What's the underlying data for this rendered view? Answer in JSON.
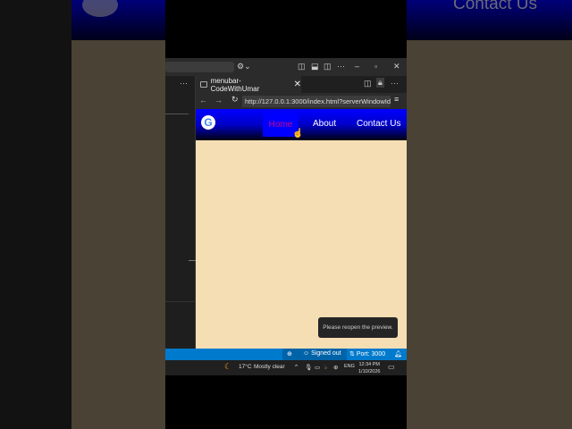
{
  "background": {
    "contact_label": "Contact Us"
  },
  "title_bar": {
    "more": "···",
    "min": "–",
    "max": "▫",
    "close": "✕"
  },
  "left_panel": {
    "more": "···"
  },
  "browser": {
    "tab_title": "menubar-CodeWithUmar",
    "url": "http://127.0.0.1:3000/index.html?serverWindowId",
    "more": "···"
  },
  "page": {
    "logo_letter": "G",
    "nav": [
      {
        "label": "Home",
        "active": true
      },
      {
        "label": "About"
      },
      {
        "label": "Contact Us"
      }
    ],
    "toast": "Please reopen the preview."
  },
  "status_bar": {
    "account": "Signed out",
    "port": "Port: 3000"
  },
  "taskbar": {
    "weather": "17°C",
    "condition": "Mostly clear",
    "lang": "ENG",
    "time": "12:34 PM",
    "date": "1/10/2026"
  },
  "colors": {
    "nav_blue": "#0000ff",
    "home_text": "#d0008a",
    "page_bg": "#f5deb3",
    "status": "#007acc"
  }
}
